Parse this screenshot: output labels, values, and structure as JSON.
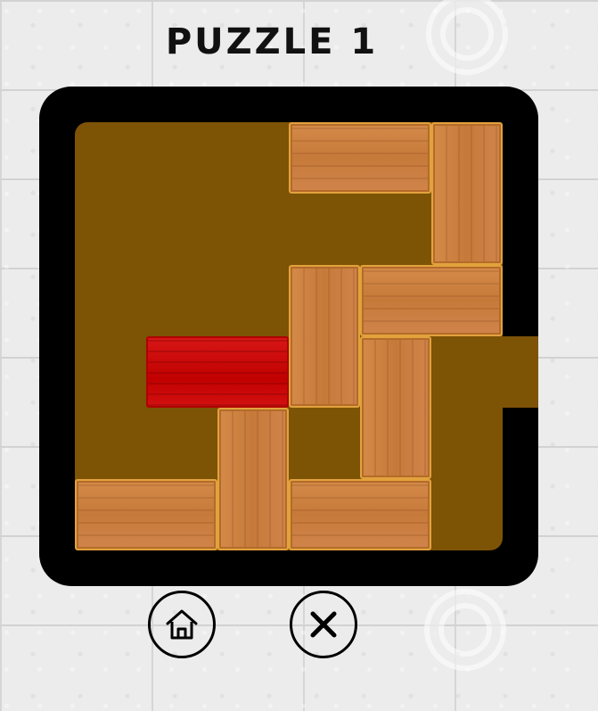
{
  "title": "PUZZLE 1",
  "colors": {
    "board": "#7d5305",
    "frame": "#000000",
    "wood": "#c67a3a",
    "target_block": "#c10000"
  },
  "board": {
    "grid_size": 6,
    "exit": {
      "row": 3,
      "side": "right"
    },
    "blocks": [
      {
        "id": "h1",
        "row": 0,
        "col": 3,
        "length": 2,
        "orientation": "horizontal",
        "type": "wood"
      },
      {
        "id": "v1",
        "row": 0,
        "col": 5,
        "length": 2,
        "orientation": "vertical",
        "type": "wood"
      },
      {
        "id": "v2",
        "row": 2,
        "col": 3,
        "length": 2,
        "orientation": "vertical",
        "type": "wood"
      },
      {
        "id": "h2",
        "row": 2,
        "col": 4,
        "length": 2,
        "orientation": "horizontal",
        "type": "wood"
      },
      {
        "id": "target",
        "row": 3,
        "col": 1,
        "length": 2,
        "orientation": "horizontal",
        "type": "target"
      },
      {
        "id": "v3",
        "row": 3,
        "col": 4,
        "length": 2,
        "orientation": "vertical",
        "type": "wood"
      },
      {
        "id": "v4",
        "row": 4,
        "col": 2,
        "length": 2,
        "orientation": "vertical",
        "type": "wood"
      },
      {
        "id": "h3",
        "row": 5,
        "col": 0,
        "length": 2,
        "orientation": "horizontal",
        "type": "wood"
      },
      {
        "id": "h4",
        "row": 5,
        "col": 3,
        "length": 2,
        "orientation": "horizontal",
        "type": "wood"
      }
    ]
  },
  "controls": [
    {
      "name": "home-button",
      "icon": "home-icon"
    },
    {
      "name": "close-button",
      "icon": "close-icon"
    }
  ]
}
